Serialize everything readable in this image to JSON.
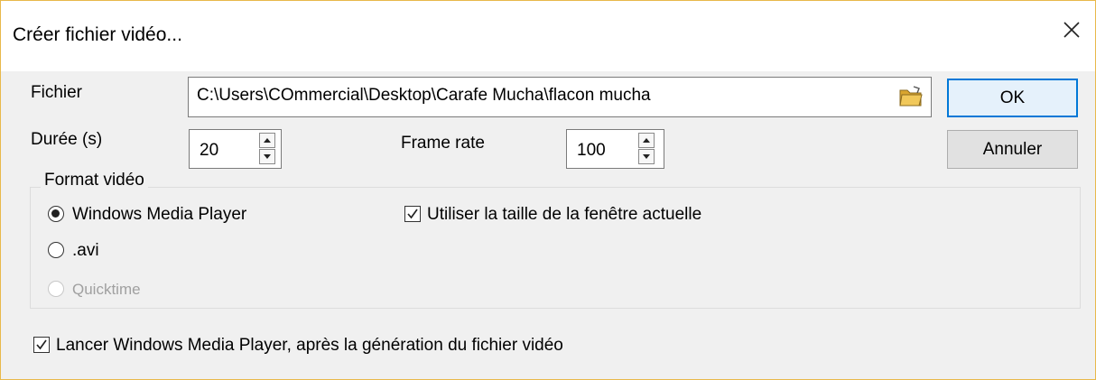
{
  "window": {
    "title": "Créer fichier vidéo..."
  },
  "file": {
    "label": "Fichier",
    "value": "C:\\Users\\COmmercial\\Desktop\\Carafe Mucha\\flacon mucha"
  },
  "duration": {
    "label": "Durée (s)",
    "value": "20"
  },
  "framerate": {
    "label": "Frame rate",
    "value": "100"
  },
  "buttons": {
    "ok": "OK",
    "cancel": "Annuler"
  },
  "format": {
    "label": "Format vidéo",
    "options": [
      {
        "label": "Windows Media Player",
        "checked": true,
        "enabled": true
      },
      {
        "label": ".avi",
        "checked": false,
        "enabled": true
      },
      {
        "label": "Quicktime",
        "checked": false,
        "enabled": false
      }
    ],
    "use_window_size": {
      "label": "Utiliser la taille de la fenêtre actuelle",
      "checked": true
    }
  },
  "launch_player": {
    "label": "Lancer Windows Media Player, après la génération du fichier vidéo",
    "checked": true
  },
  "colors": {
    "accent": "#0078d7",
    "window_border": "#e8b84a",
    "folder_icon": "#e2b13c"
  }
}
